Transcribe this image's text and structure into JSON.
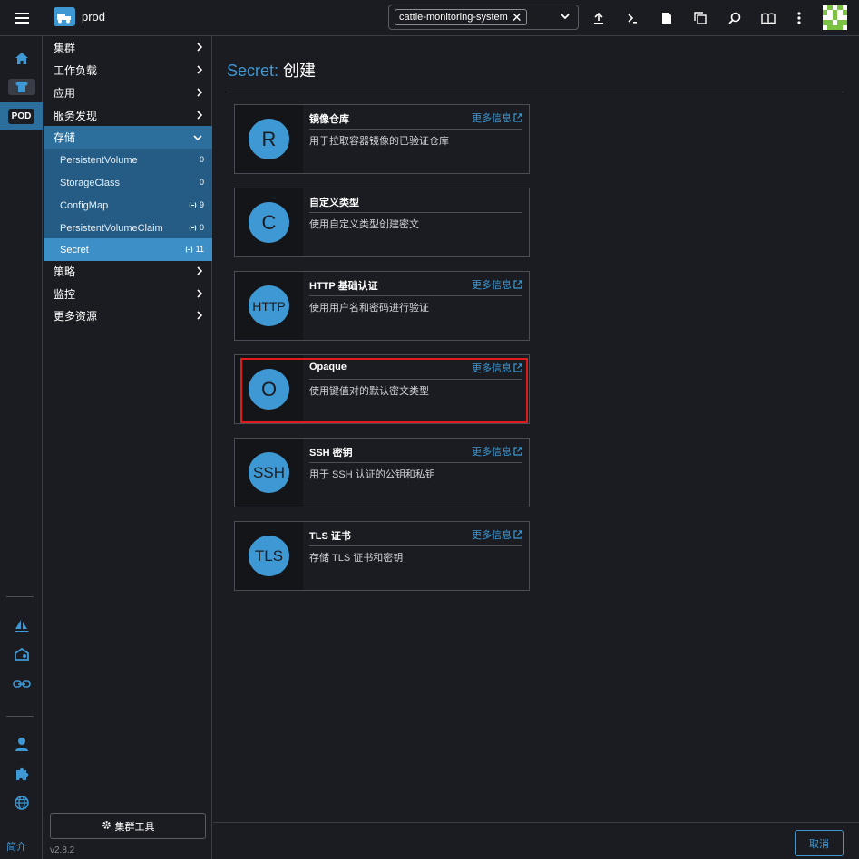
{
  "header": {
    "cluster_name": "prod",
    "namespace_chip": "cattle-monitoring-system",
    "icons": [
      "import-yaml-icon",
      "kubectl-shell-icon",
      "kubeconfig-file-icon",
      "copy-kubeconfig-icon",
      "search-icon",
      "docs-icon",
      "more-menu-icon"
    ]
  },
  "rail": {
    "pod_badge": "POD",
    "bottom_label": "简介"
  },
  "sidenav": {
    "groups": [
      {
        "label": "集群"
      },
      {
        "label": "工作负载"
      },
      {
        "label": "应用"
      },
      {
        "label": "服务发现"
      },
      {
        "label": "存储"
      },
      {
        "label": "策略"
      },
      {
        "label": "监控"
      },
      {
        "label": "更多资源"
      }
    ],
    "storage_children": [
      {
        "label": "PersistentVolume",
        "count": "0"
      },
      {
        "label": "StorageClass",
        "count": "0"
      },
      {
        "label": "ConfigMap",
        "count": "9"
      },
      {
        "label": "PersistentVolumeClaim",
        "count": "0"
      },
      {
        "label": "Secret",
        "count": "11"
      }
    ],
    "cluster_tools": "集群工具",
    "version": "v2.8.2"
  },
  "main": {
    "title_lead": "Secret:",
    "title_rest": "创建",
    "more_info": "更多信息",
    "cards": [
      {
        "letter": "R",
        "title": "镜像仓库",
        "desc": "用于拉取容器镜像的已验证仓库",
        "has_more": true
      },
      {
        "letter": "C",
        "title": "自定义类型",
        "desc": "使用自定义类型创建密文",
        "has_more": false
      },
      {
        "letter": "HTTP",
        "title": "HTTP 基础认证",
        "desc": "使用用户名和密码进行验证",
        "has_more": true
      },
      {
        "letter": "O",
        "title": "Opaque",
        "desc": "使用键值对的默认密文类型",
        "has_more": true
      },
      {
        "letter": "SSH",
        "title": "SSH 密钥",
        "desc": "用于 SSH 认证的公钥和私钥",
        "has_more": true
      },
      {
        "letter": "TLS",
        "title": "TLS 证书",
        "desc": "存储 TLS 证书和密钥",
        "has_more": true
      }
    ],
    "cancel": "取消"
  },
  "colors": {
    "accent": "#3d98d3",
    "background": "#1b1c21",
    "nav_active": "#2c6e9c",
    "highlight": "#e11b1b"
  }
}
